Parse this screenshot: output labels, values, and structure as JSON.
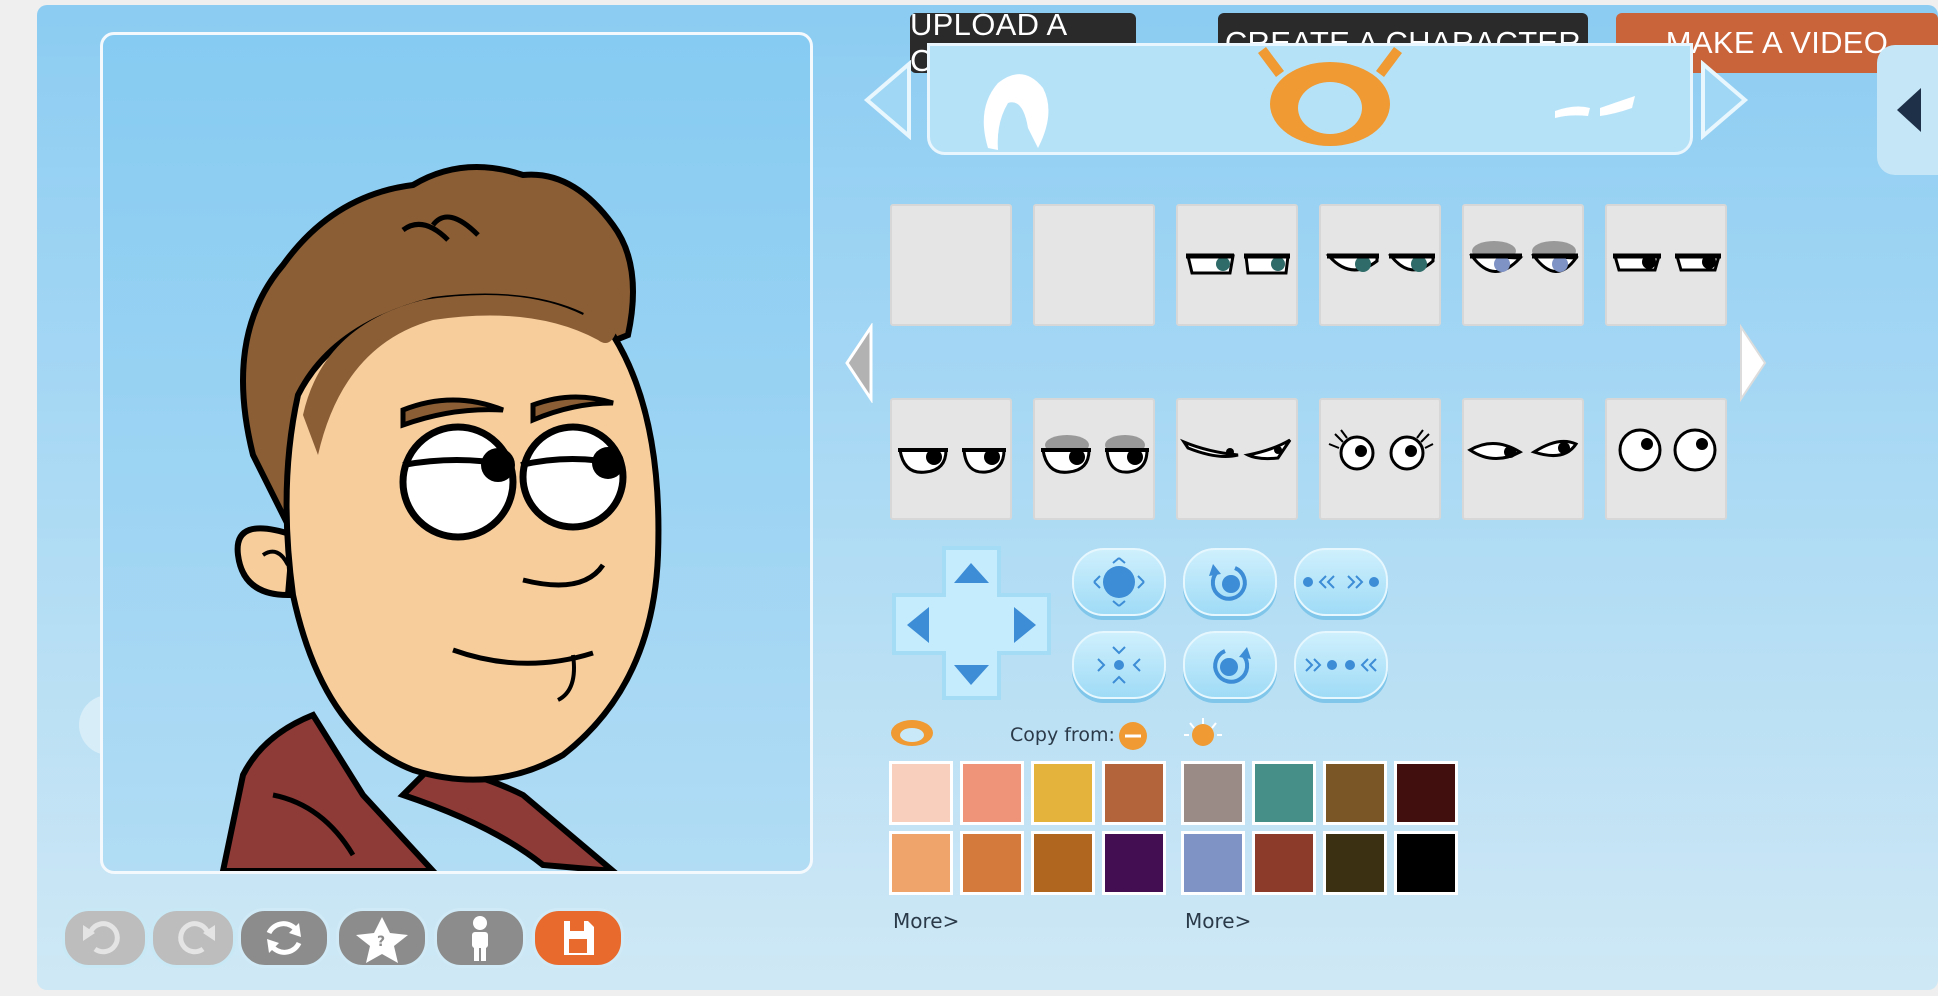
{
  "header": {
    "upload_label": "UPLOAD A CHAR",
    "create_label": "CREATE A CHARACTER",
    "video_label": "MAKE A VIDEO"
  },
  "categories": {
    "items": [
      "hair-icon",
      "eye-icon",
      "brow-icon"
    ],
    "selected": "eye-icon"
  },
  "eye_options": {
    "row1": [
      "blank",
      "blank",
      "half-closed-teal",
      "half-closed-teal-2",
      "blue-shadowed",
      "narrow-black"
    ],
    "row2": [
      "half-closed-black",
      "shadowed-black",
      "lashes-wink",
      "lashes-round",
      "side-glance",
      "round-open"
    ]
  },
  "colors": {
    "copy_from_label": "Copy from:",
    "skin_swatches": [
      "#f8cfbd",
      "#ef9478",
      "#e3b33c",
      "#b4643b",
      "#efa46b",
      "#d47a3d",
      "#b0661f",
      "#430e52"
    ],
    "eye_swatches": [
      "#9b8b86",
      "#468f88",
      "#7a5526",
      "#420f0f",
      "#7f93c4",
      "#8c3b2b",
      "#3b3011",
      "#000000"
    ],
    "more_label_1": "More>",
    "more_label_2": "More>",
    "accent": "#ef8b2c"
  },
  "toolbar": {
    "items": [
      "undo-icon",
      "redo-icon",
      "refresh-icon",
      "random-icon",
      "body-icon",
      "save-icon"
    ],
    "save_color": "#e86a2d"
  }
}
